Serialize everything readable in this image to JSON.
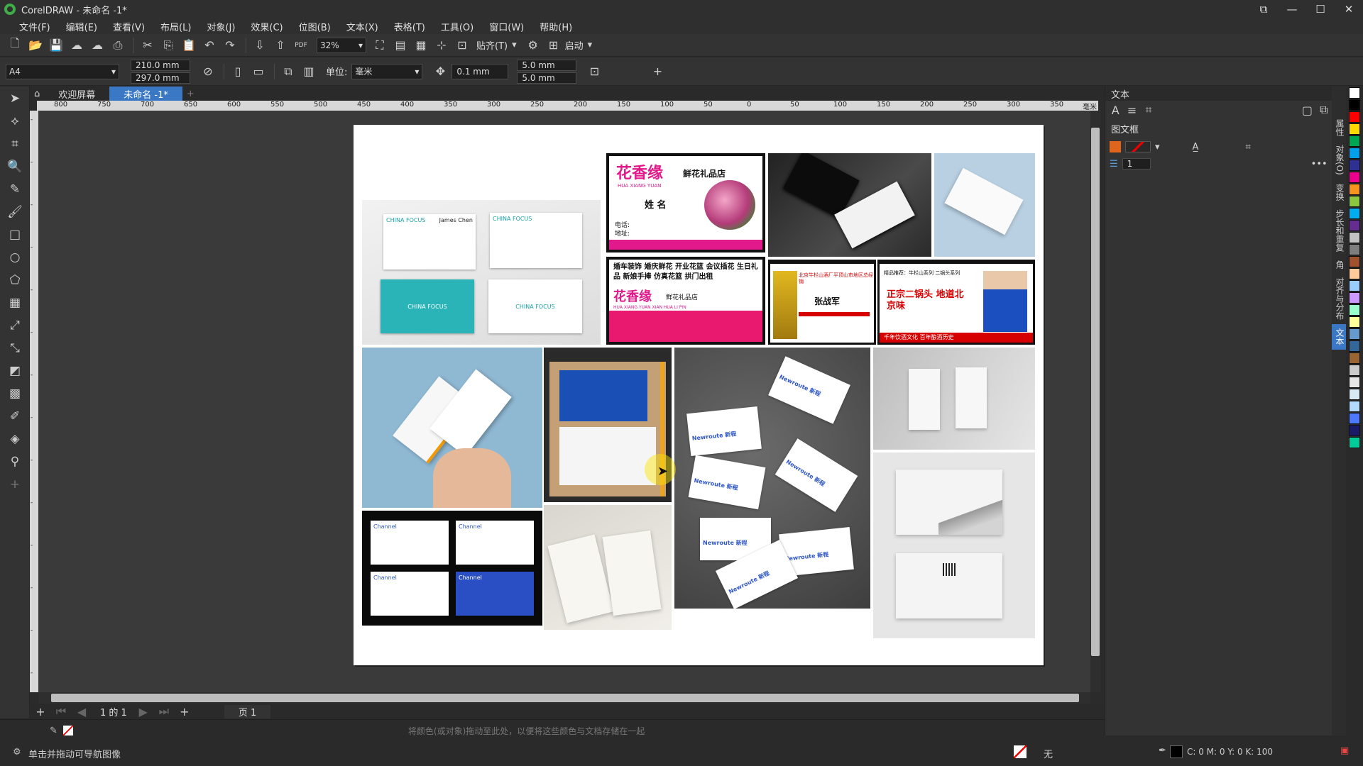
{
  "window": {
    "title": "CorelDRAW - 未命名 -1*"
  },
  "menu": [
    "文件(F)",
    "编辑(E)",
    "查看(V)",
    "布局(L)",
    "对象(J)",
    "效果(C)",
    "位图(B)",
    "文本(X)",
    "表格(T)",
    "工具(O)",
    "窗口(W)",
    "帮助(H)"
  ],
  "toolbar": {
    "zoom": "32%",
    "snap": "贴齐(T)",
    "launch": "启动"
  },
  "propertybar": {
    "page_size": "A4",
    "width": "210.0 mm",
    "height": "297.0 mm",
    "units_label": "单位:",
    "units": "毫米",
    "nudge": "0.1 mm",
    "dup_x": "5.0 mm",
    "dup_y": "5.0 mm"
  },
  "tabs": {
    "welcome": "欢迎屏幕",
    "doc": "未命名 -1*"
  },
  "ruler": {
    "h_ticks": [
      "800",
      "750",
      "700",
      "650",
      "600",
      "550",
      "500",
      "450",
      "400",
      "350",
      "300",
      "250",
      "200",
      "150",
      "100",
      "50",
      "0",
      "50",
      "100",
      "150",
      "200",
      "250",
      "300",
      "350"
    ],
    "unit": "毫米"
  },
  "page_content": {
    "cf_brand": "CHINA FOCUS",
    "cf_name1": "James Chen",
    "flower_title": "花香缘",
    "flower_shop": "鲜花礼品店",
    "flower_pinyin": "HUA XIANG YUAN",
    "flower_name": "姓 名",
    "flower_tel": "电话:",
    "flower_addr": "地址:",
    "flower_services": "婚车装饰 婚庆鲜花 开业花篮 会议插花 生日礼品 新娘手捧 仿真花篮 拱门出租",
    "flower_pinyin2": "HUA XIANG YUAN XIAN HUA LI PIN",
    "liquor_line": "北京牛栏山酒厂平顶山市地区总经销",
    "liquor_name": "张战军",
    "liquor_title": "精品推荐：牛栏山系列 二锅头系列",
    "liquor_slogan": "正宗二锅头 地道北京味",
    "liquor_bottom": "千年饮酒文化 百年酿酒历史",
    "newroute": "Newroute 新程",
    "channel": "Channel"
  },
  "pagenav": {
    "count": "1 的 1",
    "page_tab": "页 1"
  },
  "status": {
    "hint": "单击并拖动可导航图像",
    "center_hint": "将颜色(或对象)拖动至此处，以便将这些颜色与文档存储在一起",
    "fill_none": "无",
    "cmyk": "C: 0 M: 0 Y: 0 K: 100"
  },
  "docker": {
    "title": "文本",
    "section": "图文框",
    "columns": "1"
  },
  "sidetabs": [
    "属性",
    "对象(O)",
    "变换",
    "步长和重复",
    "角",
    "对齐与分布",
    "文本"
  ],
  "palette_colors": [
    "#ffffff",
    "#000000",
    "#ff0000",
    "#ffd800",
    "#00a651",
    "#00a0e9",
    "#2e3192",
    "#ec008c",
    "#f7941d",
    "#8dc63f",
    "#00aeef",
    "#662d91",
    "#c2c2c2",
    "#7f7f7f",
    "#a0522d",
    "#ffcc99",
    "#99ccff",
    "#cc99ff",
    "#99ffcc",
    "#ffff99",
    "#6699cc",
    "#336699",
    "#996633",
    "#cccccc",
    "#e6e6e6",
    "#d9e8f5",
    "#b3d9ff",
    "#4d79ff",
    "#1a1a66",
    "#00cc99"
  ]
}
